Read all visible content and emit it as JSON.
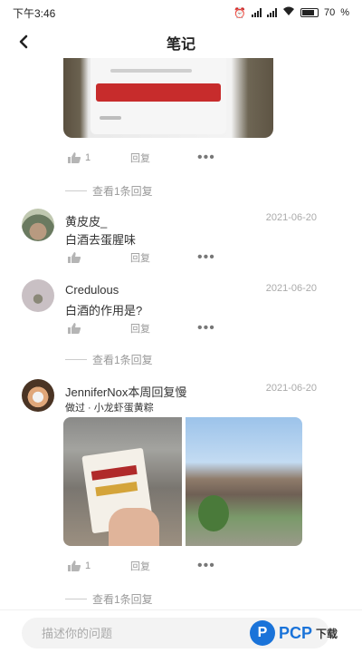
{
  "status_bar": {
    "time": "下午3:46",
    "battery": "70"
  },
  "header": {
    "title": "笔记"
  },
  "top_post": {
    "likes": "1",
    "reply": "回复",
    "view_replies": "查看1条回复"
  },
  "comments": [
    {
      "name": "黄皮皮_",
      "date": "2021-06-20",
      "text": "白酒去蛋腥味",
      "reply": "回复",
      "view_replies": ""
    },
    {
      "name": "Credulous",
      "date": "2021-06-20",
      "text": "白酒的作用是?",
      "reply": "回复",
      "view_replies": "查看1条回复"
    },
    {
      "name": "JenniferNox本周回复慢",
      "date": "2021-06-20",
      "sub": "做过 · 小龙虾蛋黄粽",
      "likes": "1",
      "reply": "回复",
      "view_replies": "查看1条回复"
    }
  ],
  "bottom_bar": {
    "placeholder": "描述你的问题"
  },
  "watermark": {
    "logo": "P",
    "text": "PCP",
    "text2": "下载"
  },
  "colors": {
    "accent": "#1a73d9",
    "muted": "#999999"
  },
  "icons": [
    "back-arrow-icon",
    "alarm-icon",
    "signal-icon",
    "wifi-icon",
    "battery-icon",
    "thumbs-up-icon",
    "more-icon"
  ]
}
